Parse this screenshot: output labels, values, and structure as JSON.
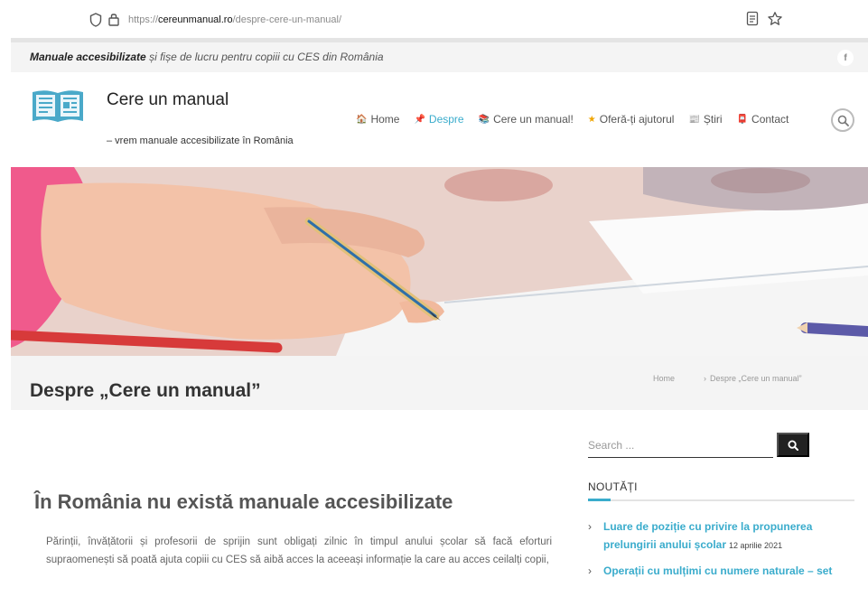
{
  "browser": {
    "url_prefix": "https://",
    "url_host": "cereunmanual.ro",
    "url_path": "/despre-cere-un-manual/"
  },
  "topbar": {
    "tagline_bold": "Manuale accesibilizate",
    "tagline_rest": " și fișe de lucru pentru copiii cu CES din România",
    "facebook_label": "f"
  },
  "header": {
    "site_title": "Cere un manual",
    "site_description": "– vrem manuale accesibilizate în România"
  },
  "nav": {
    "items": [
      {
        "label": "Home",
        "icon": "house-icon",
        "glyph": "🏠"
      },
      {
        "label": "Despre",
        "icon": "pushpin-icon",
        "glyph": "📌",
        "active": true
      },
      {
        "label": "Cere un manual!",
        "icon": "books-icon",
        "glyph": "📚"
      },
      {
        "label": "Oferă-ți ajutorul",
        "icon": "star-icon",
        "glyph": "★"
      },
      {
        "label": "Știri",
        "icon": "news-icon",
        "glyph": "📰"
      },
      {
        "label": "Contact",
        "icon": "postal-icon",
        "glyph": "📮"
      }
    ]
  },
  "page": {
    "title": "Despre „Cere un manual”",
    "breadcrumb": {
      "home": "Home",
      "sep": "›",
      "current": "Despre „Cere un manual”"
    }
  },
  "main": {
    "heading": "În România nu există manuale accesibilizate",
    "paragraph": "Părinții, învățătorii și profesorii de sprijin sunt obligați zilnic în timpul anului școlar să facă eforturi supraomenești să poată ajuta copiii cu CES să aibă acces la aceeași informație la care au acces ceilalți copii,"
  },
  "sidebar": {
    "search_placeholder": "Search ...",
    "news_title": "NOUTĂȚI",
    "news": [
      {
        "title": "Luare de poziție cu privire la propunerea prelungirii anului școlar",
        "date": "12 aprilie 2021"
      },
      {
        "title": "Operații cu mulțimi cu numere naturale – set",
        "date": ""
      }
    ]
  },
  "colors": {
    "accent": "#3aaccc",
    "logo": "#4aa9c9",
    "top_strip": "#f4f4f4"
  }
}
